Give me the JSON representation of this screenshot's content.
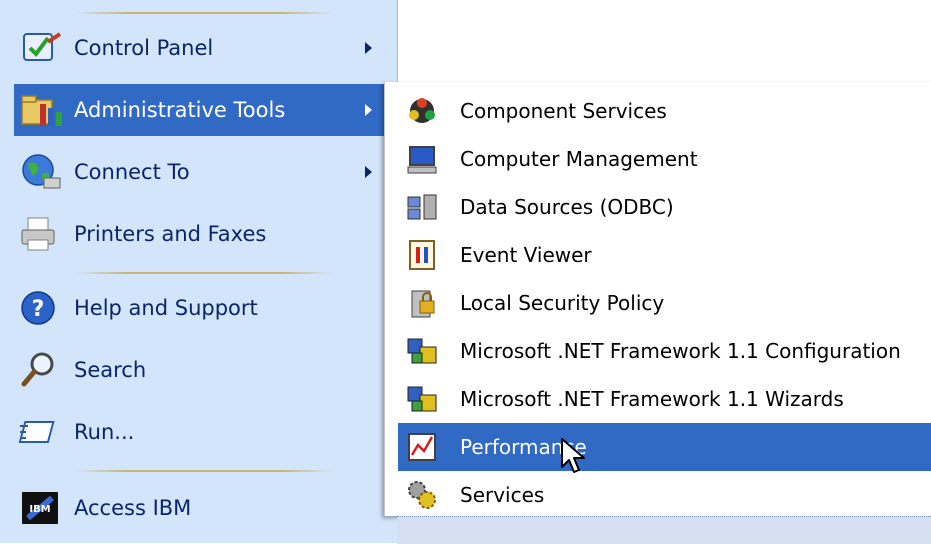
{
  "start_menu": {
    "items": [
      {
        "label": "Control Panel",
        "icon": "control-panel-icon",
        "has_submenu": true
      },
      {
        "label": "Administrative Tools",
        "icon": "administrative-tools-icon",
        "has_submenu": true,
        "selected": true
      },
      {
        "label": "Connect To",
        "icon": "connect-to-icon",
        "has_submenu": true
      },
      {
        "label": "Printers and Faxes",
        "icon": "printer-icon",
        "has_submenu": false
      },
      {
        "label": "Help and Support",
        "icon": "help-icon",
        "has_submenu": false
      },
      {
        "label": "Search",
        "icon": "search-icon",
        "has_submenu": false
      },
      {
        "label": "Run...",
        "icon": "run-icon",
        "has_submenu": false
      },
      {
        "label": "Access IBM",
        "icon": "ibm-icon",
        "has_submenu": false
      }
    ]
  },
  "admin_tools_submenu": {
    "items": [
      {
        "label": "Component Services",
        "icon": "component-services-icon"
      },
      {
        "label": "Computer Management",
        "icon": "computer-management-icon"
      },
      {
        "label": "Data Sources (ODBC)",
        "icon": "data-sources-icon"
      },
      {
        "label": "Event Viewer",
        "icon": "event-viewer-icon"
      },
      {
        "label": "Local Security Policy",
        "icon": "security-policy-icon"
      },
      {
        "label": "Microsoft .NET Framework 1.1 Configuration",
        "icon": "dotnet-config-icon"
      },
      {
        "label": "Microsoft .NET Framework 1.1 Wizards",
        "icon": "dotnet-wizards-icon"
      },
      {
        "label": "Performance",
        "icon": "performance-icon",
        "selected": true
      },
      {
        "label": "Services",
        "icon": "services-icon"
      }
    ]
  },
  "colors": {
    "menu_background": "#d3e5fa",
    "selection": "#316ac5",
    "text": "#0a246a"
  }
}
